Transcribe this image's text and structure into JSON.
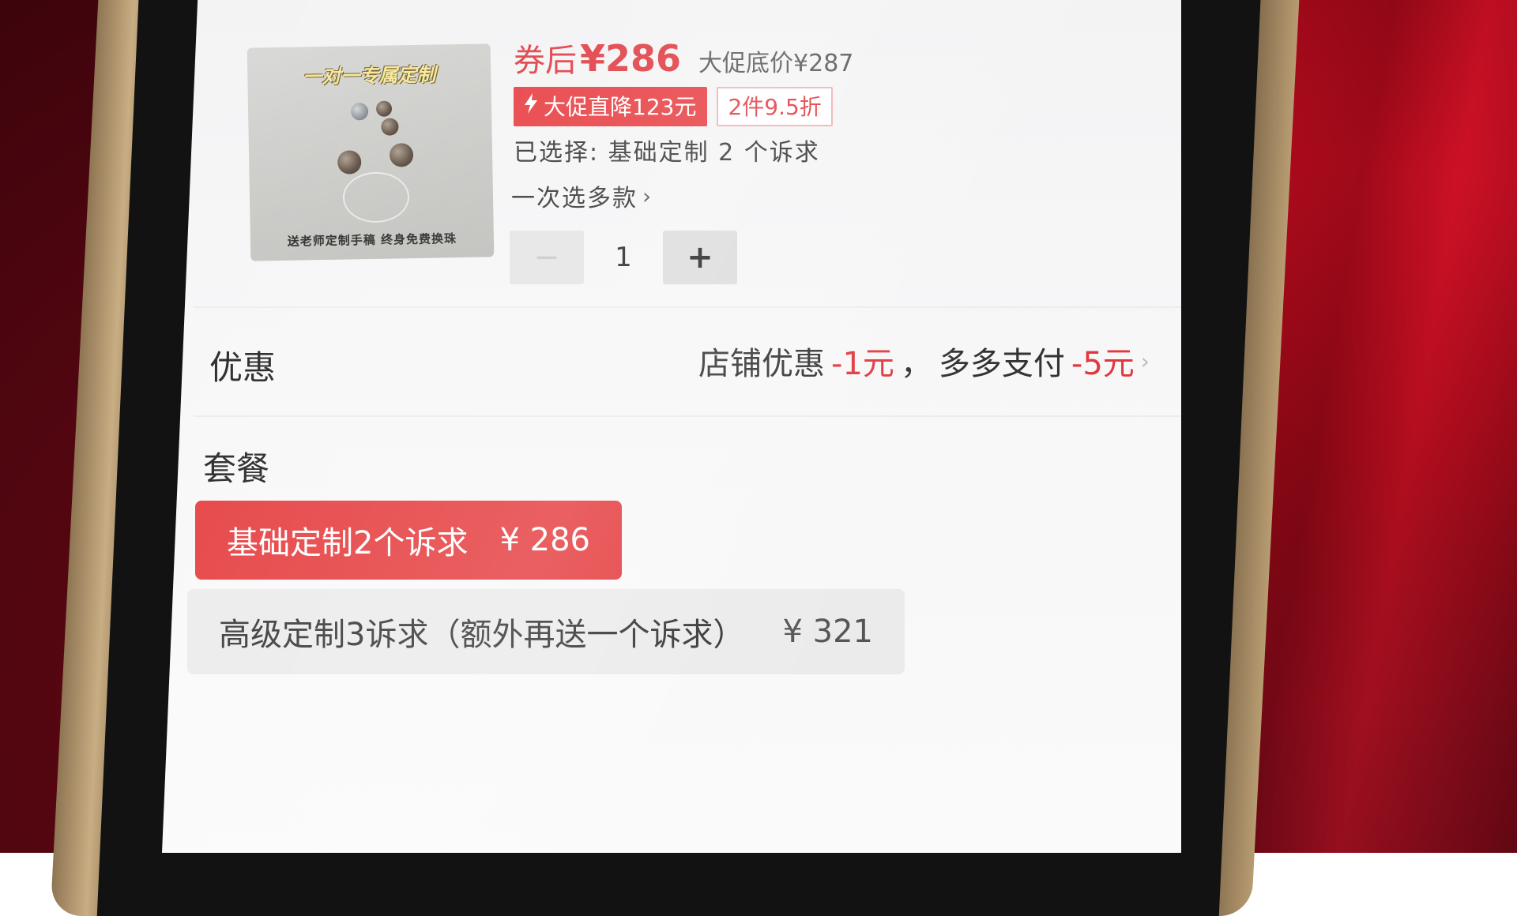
{
  "product": {
    "image_title": "一对一专属定制",
    "image_caption": "送老师定制手稿 终身免费换珠",
    "price_prefix": "券后",
    "price": "¥286",
    "floor_price_label": "大促底价",
    "floor_price": "¥287",
    "promo_tag": "大促直降123元",
    "promo_icon": "lightning-icon",
    "bundle_tag": "2件9.5折",
    "selected_text": "已选择: 基础定制 2 个诉求",
    "multi_select_label": "一次选多款",
    "quantity": "1",
    "minus_symbol": "−",
    "plus_symbol": "+"
  },
  "discount": {
    "label": "优惠",
    "shop_text": "店铺优惠",
    "shop_amount": "-1元",
    "separator": "，",
    "pay_text": "多多支付",
    "pay_amount": "-5元",
    "chevron": "›"
  },
  "packages": {
    "label": "套餐",
    "items": [
      {
        "name": "基础定制2个诉求",
        "price": "¥ 286",
        "selected": true
      },
      {
        "name": "高级定制3诉求（额外再送一个诉求）",
        "price": "¥ 321",
        "selected": false
      }
    ]
  },
  "colors": {
    "accent_red": "#e0383f",
    "selected_bg": "#e53d3f",
    "unselected_bg": "#ebebeb"
  }
}
